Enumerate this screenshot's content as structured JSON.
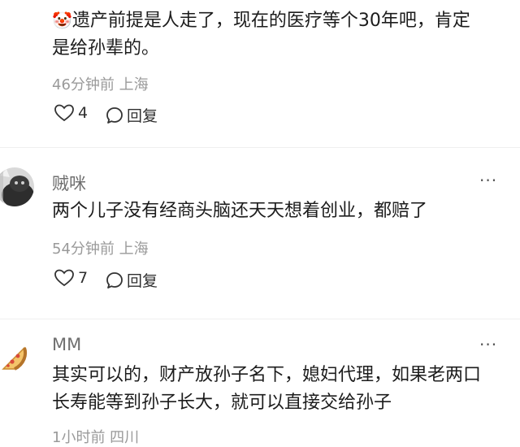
{
  "comments": [
    {
      "emoji": "🤡",
      "text_line1": "遗产前提是人走了，现在的医疗等个30年吧，肯定",
      "text_line2": "是给孙辈的。",
      "meta": "46分钟前 上海",
      "likes": "4",
      "reply_label": "回复"
    },
    {
      "username": "贼咪",
      "text_line1": "两个儿子没有经商头脑还天天想着创业，都赔了",
      "meta": "54分钟前 上海",
      "likes": "7",
      "reply_label": "回复",
      "more": "···"
    },
    {
      "username": "MM",
      "text_line1": "其实可以的，财产放孙子名下，媳妇代理，如果老两口",
      "text_line2": "长寿能等到孙子长大，就可以直接交给孙子",
      "meta": "1小时前 四川",
      "more": "···"
    }
  ],
  "icons": {
    "like": "heart-outline-icon",
    "reply": "speech-bubble-icon",
    "more": "more-dots-icon"
  },
  "colors": {
    "text": "#1c1c1c",
    "meta": "#9a9a9a",
    "username": "#6f6f6f"
  }
}
